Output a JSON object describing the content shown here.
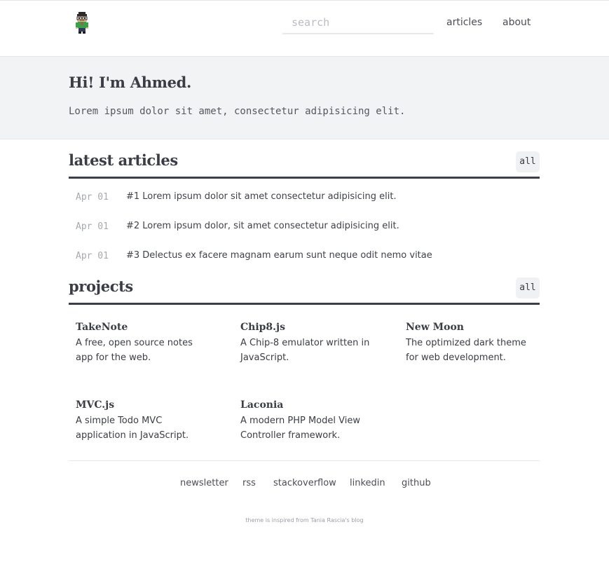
{
  "header": {
    "logo_icon": "pixel-avatar-icon",
    "search": {
      "placeholder": "search",
      "value": ""
    },
    "nav": [
      {
        "label": "articles"
      },
      {
        "label": "about"
      }
    ]
  },
  "hero": {
    "title": "Hi! I'm Ahmed.",
    "subtitle": "Lorem ipsum dolor sit amet, consectetur adipisicing elit."
  },
  "articles_section": {
    "title": "latest articles",
    "all_label": "all",
    "items": [
      {
        "date": "Apr 01",
        "title": "#1 Lorem ipsum dolor sit amet consectetur adipisicing elit."
      },
      {
        "date": "Apr 01",
        "title": "#2 Lorem ipsum dolor, sit amet consectetur adipisicing elit."
      },
      {
        "date": "Apr 01",
        "title": "#3 Delectus ex facere magnam earum sunt neque odit nemo vitae"
      }
    ]
  },
  "projects_section": {
    "title": "projects",
    "all_label": "all",
    "items": [
      {
        "name": "TakeNote",
        "description": "A free, open source notes app for the web."
      },
      {
        "name": "Chip8.js",
        "description": "A Chip-8 emulator written in JavaScript."
      },
      {
        "name": "New Moon",
        "description": "The optimized dark theme for web development."
      },
      {
        "name": "MVC.js",
        "description": "A simple Todo MVC application in JavaScript."
      },
      {
        "name": "Laconia",
        "description": "A modern PHP Model View Controller framework."
      }
    ]
  },
  "footer": {
    "links": [
      {
        "label": "newsletter"
      },
      {
        "label": "rss"
      },
      {
        "label": "stackoverflow"
      },
      {
        "label": "linkedin"
      },
      {
        "label": "github"
      }
    ],
    "credit": "theme is inspired from Tania Rascia's blog"
  },
  "colors": {
    "text": "#3a3d45",
    "hero_bg": "#f2f3f4",
    "rule": "#3c3f4a",
    "muted": "#a6a9b0"
  }
}
